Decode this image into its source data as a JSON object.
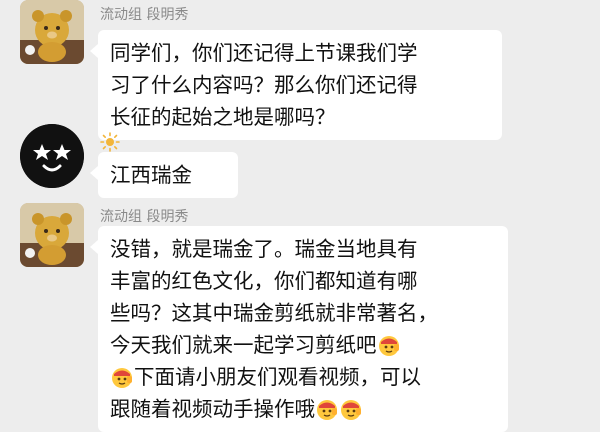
{
  "messages": [
    {
      "sender": "流动组 段明秀",
      "lines": [
        "同学们，你们还记得上节课我们学",
        "习了什么内容吗？那么你们还记得",
        "长征的起始之地是哪吗？"
      ]
    },
    {
      "sender_icon": "sun-icon",
      "text": "江西瑞金"
    },
    {
      "sender": "流动组 段明秀",
      "lines": [
        "没错，就是瑞金了。瑞金当地具有",
        "丰富的红色文化，你们都知道有哪",
        "些吗？这其中瑞金剪纸就非常著名，",
        "今天我们就来一起学习剪纸吧",
        "下面请小朋友们观看视频，可以",
        "跟随着视频动手操作哦"
      ]
    }
  ],
  "icons": {
    "teacher_avatar": "teddy-bear-avatar",
    "student_avatar": "smiley-star-eyes-avatar",
    "emoji": "salute-face-emoji"
  }
}
